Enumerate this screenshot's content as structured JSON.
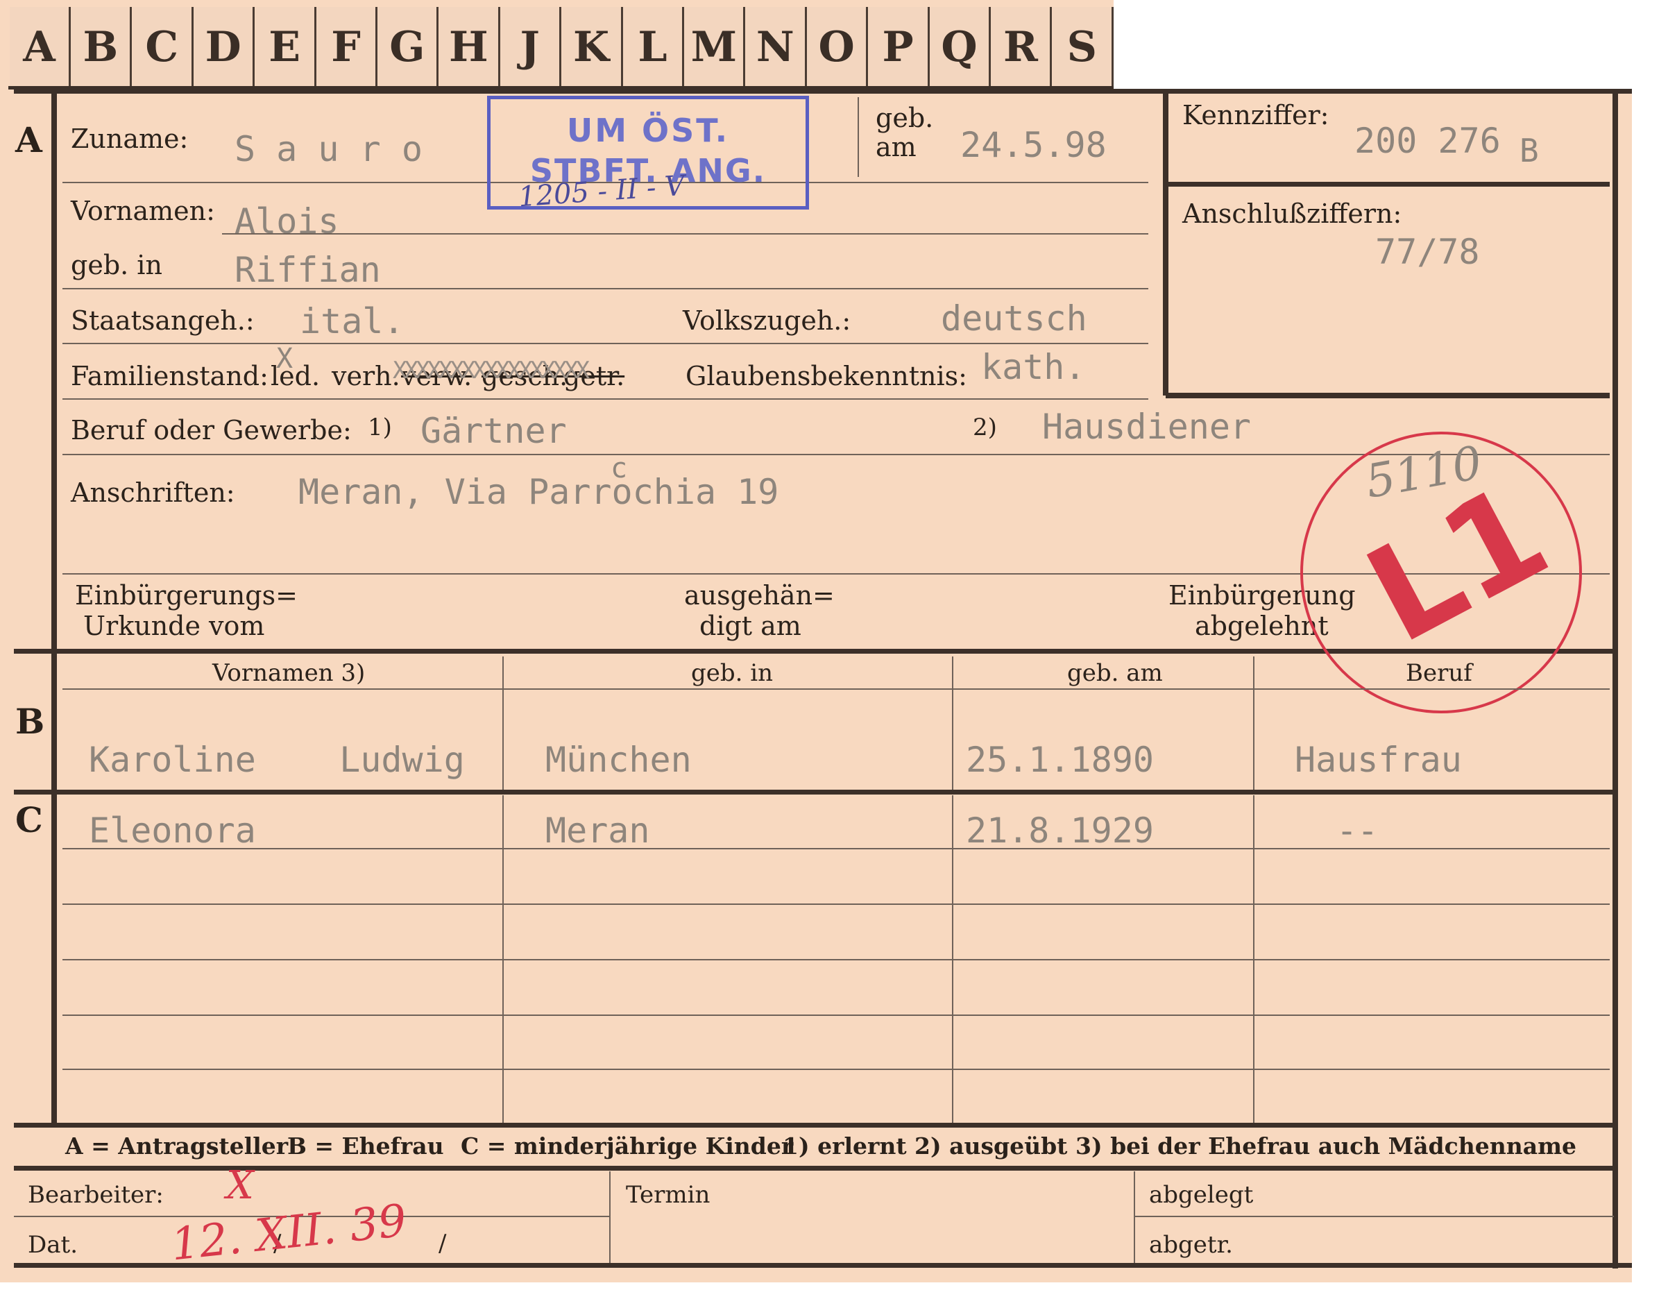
{
  "tabs": [
    "A",
    "B",
    "C",
    "D",
    "E",
    "F",
    "G",
    "H",
    "J",
    "K",
    "L",
    "M",
    "N",
    "O",
    "P",
    "Q",
    "R",
    "S"
  ],
  "sections": {
    "a": "A",
    "b": "B",
    "c": "C"
  },
  "applicant": {
    "surname_label": "Zuname:",
    "surname": "S a u r o",
    "born_on_label_1": "geb.",
    "born_on_label_2": "am",
    "born_on": "24.5.98",
    "first_names_label": "Vornamen:",
    "first_names": "Alois",
    "born_in_label": "geb. in",
    "born_in": "Riffian",
    "citizenship_label": "Staatsangeh.:",
    "citizenship": "ital.",
    "ethnicity_label": "Volkszugeh.:",
    "ethnicity": "deutsch",
    "marital_label": "Familienstand:",
    "marital_options": {
      "led": "led.",
      "verh": "verh.",
      "verw": "verw.",
      "gesch": "gesch.",
      "getr": "getr."
    },
    "marital_mark": "X",
    "marital_strikeout": "XXXXXXXXXXXXXXXXX",
    "religion_label": "Glaubensbekenntnis:",
    "religion": "kath.",
    "profession_label": "Beruf oder Gewerbe:",
    "profession_note_1": "1)",
    "profession_1": "Gärtner",
    "profession_note_2": "2)",
    "profession_2": "Hausdiener",
    "address_label": "Anschriften:",
    "address": "Meran, Via Parrochia 19",
    "address_correction": "c",
    "naturalization_label_1": "Einbürgerungs=",
    "naturalization_label_2": "Urkunde vom",
    "handed_label_1": "ausgehän=",
    "handed_label_2": "digt am",
    "rejected_label_1": "Einbürgerung",
    "rejected_label_2": "abgelehnt"
  },
  "stamp": {
    "line1": "UM ÖST.",
    "line2": "STBFT. ANG.",
    "handwritten": "1205 - II - V"
  },
  "code_box": {
    "kennziffer_label": "Kennziffer:",
    "kennziffer": "200 276",
    "kennziffer_suffix": "B",
    "anschluss_label": "Anschlußziffern:",
    "anschluss": "77/78"
  },
  "circle_stamp": {
    "number": "5110",
    "code": "L1"
  },
  "family_table": {
    "headers": [
      "Vornamen 3)",
      "geb. in",
      "geb. am",
      "Beruf"
    ],
    "spouse": [
      "Karoline    Ludwig",
      "München",
      "25.1.1890",
      "Hausfrau"
    ],
    "children": [
      [
        "Eleonora",
        "Meran",
        "21.8.1929",
        "--"
      ]
    ]
  },
  "legend": {
    "a": "A = Antragsteller",
    "b": "B = Ehefrau",
    "c": "C = minderjährige Kinder",
    "n1": "1) erlernt",
    "n2": "2) ausgeübt",
    "n3": "3) bei der Ehefrau auch Mädchenname"
  },
  "footer": {
    "bearbeiter_label": "Bearbeiter:",
    "dat_label": "Dat.",
    "slash": "/",
    "termin_label": "Termin",
    "abgelegt_label": "abgelegt",
    "abgetr_label": "abgetr.",
    "handwritten_date": "12. XII. 39",
    "handwritten_mark": "X"
  },
  "colors": {
    "card": "#f8d9c0",
    "stamp_blue": "#5a5fc2",
    "stamp_red": "#d7384a",
    "ink": "#2a211a",
    "typed": "#8e857c"
  }
}
